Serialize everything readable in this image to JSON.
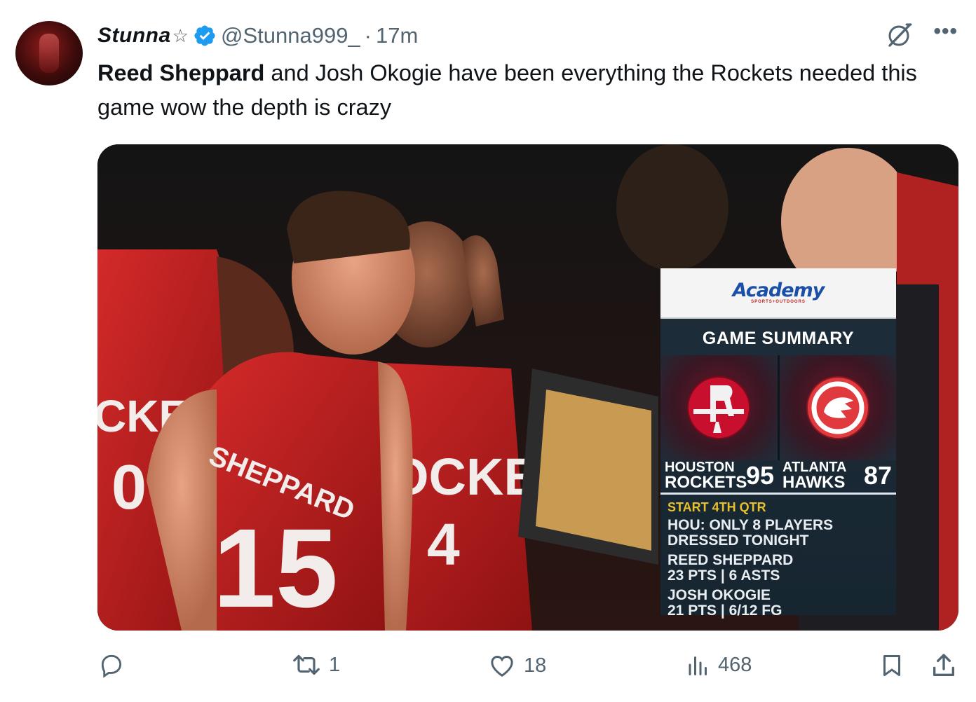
{
  "author": {
    "display_name": "Stunna",
    "star": "☆",
    "handle": "@Stunna999_",
    "separator": "·",
    "time": "17m"
  },
  "tweet": {
    "bold_name": "Reed Sheppard",
    "text": " and Josh Okogie have been everything the Rockets needed this game wow the depth is crazy"
  },
  "media": {
    "jersey_texts": [
      "CKETS",
      "0",
      "SHEPPARD",
      "15",
      "OCKETS",
      "4"
    ],
    "scoreboard": {
      "sponsor": "Academy",
      "sponsor_sub": "SPORTS+OUTDOORS",
      "title": "GAME SUMMARY",
      "home": {
        "city": "HOUSTON",
        "name": "ROCKETS",
        "score": "95"
      },
      "away": {
        "city": "ATLANTA",
        "name": "HAWKS",
        "score": "87"
      },
      "quarter": "START 4TH QTR",
      "note_line1": "HOU: ONLY 8 PLAYERS",
      "note_line2": "DRESSED TONIGHT",
      "player1_name": "REED SHEPPARD",
      "player1_stats": "23 PTS | 6 ASTS",
      "player2_name": "JOSH OKOGIE",
      "player2_stats": "21 PTS | 6/12 FG"
    }
  },
  "actions": {
    "retweets": "1",
    "likes": "18",
    "views": "468"
  },
  "colors": {
    "verified_blue": "#1d9bf0",
    "muted": "#536471",
    "rockets_red": "#c8102e"
  },
  "icons": [
    "verified-badge-icon",
    "grok-icon",
    "more-icon",
    "reply-icon",
    "retweet-icon",
    "like-icon",
    "views-icon",
    "bookmark-icon",
    "share-icon"
  ]
}
